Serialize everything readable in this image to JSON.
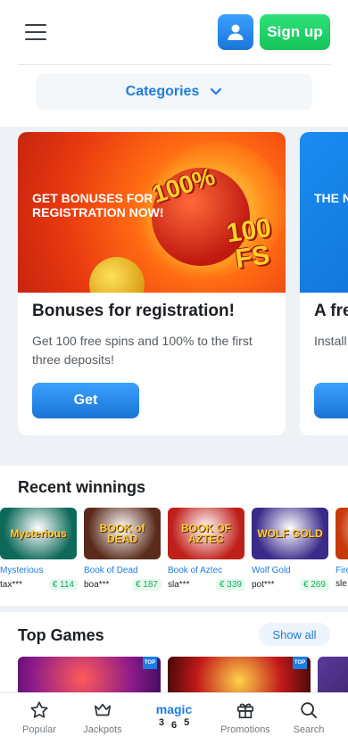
{
  "header": {
    "signup_label": "Sign up",
    "categories_label": "Categories"
  },
  "promos": [
    {
      "banner_text": "GET BONUSES FOR REGISTRATION NOW!",
      "badge_percent": "100%",
      "badge_fs": "100 FS",
      "title": "Bonuses for registration!",
      "description": "Get 100 free spins and 100% to the first three deposits!",
      "button_label": "Get"
    },
    {
      "banner_text": "THE N OF WI ON YO",
      "title": "A fre",
      "description": "Install",
      "button_label": ""
    }
  ],
  "recent_winnings": {
    "title": "Recent winnings",
    "items": [
      {
        "game": "Mysterious",
        "user": "tax***",
        "amount": "€ 114",
        "thumb_text": "Mysterious",
        "color": "#0d6a5a"
      },
      {
        "game": "Book of Dead",
        "user": "boa***",
        "amount": "€ 187",
        "thumb_text": "BOOK of DEAD",
        "color": "#5a2a1a"
      },
      {
        "game": "Book of Aztec",
        "user": "sla***",
        "amount": "€ 339",
        "thumb_text": "BOOK OF AZTEC",
        "color": "#c0201a"
      },
      {
        "game": "Wolf Gold",
        "user": "pot***",
        "amount": "€ 269",
        "thumb_text": "WOLF GOLD",
        "color": "#3a2a8a"
      },
      {
        "game": "Fire",
        "user": "sle",
        "amount": "",
        "thumb_text": "",
        "color": "#c83a0a"
      }
    ]
  },
  "top_games": {
    "title": "Top Games",
    "show_all_label": "Show all",
    "badge": "TOP"
  },
  "bottom_nav": {
    "popular": "Popular",
    "jackpots": "Jackpots",
    "magic": "magic",
    "magic_numbers": [
      "3",
      "6",
      "5"
    ],
    "promotions": "Promotions",
    "search": "Search"
  }
}
